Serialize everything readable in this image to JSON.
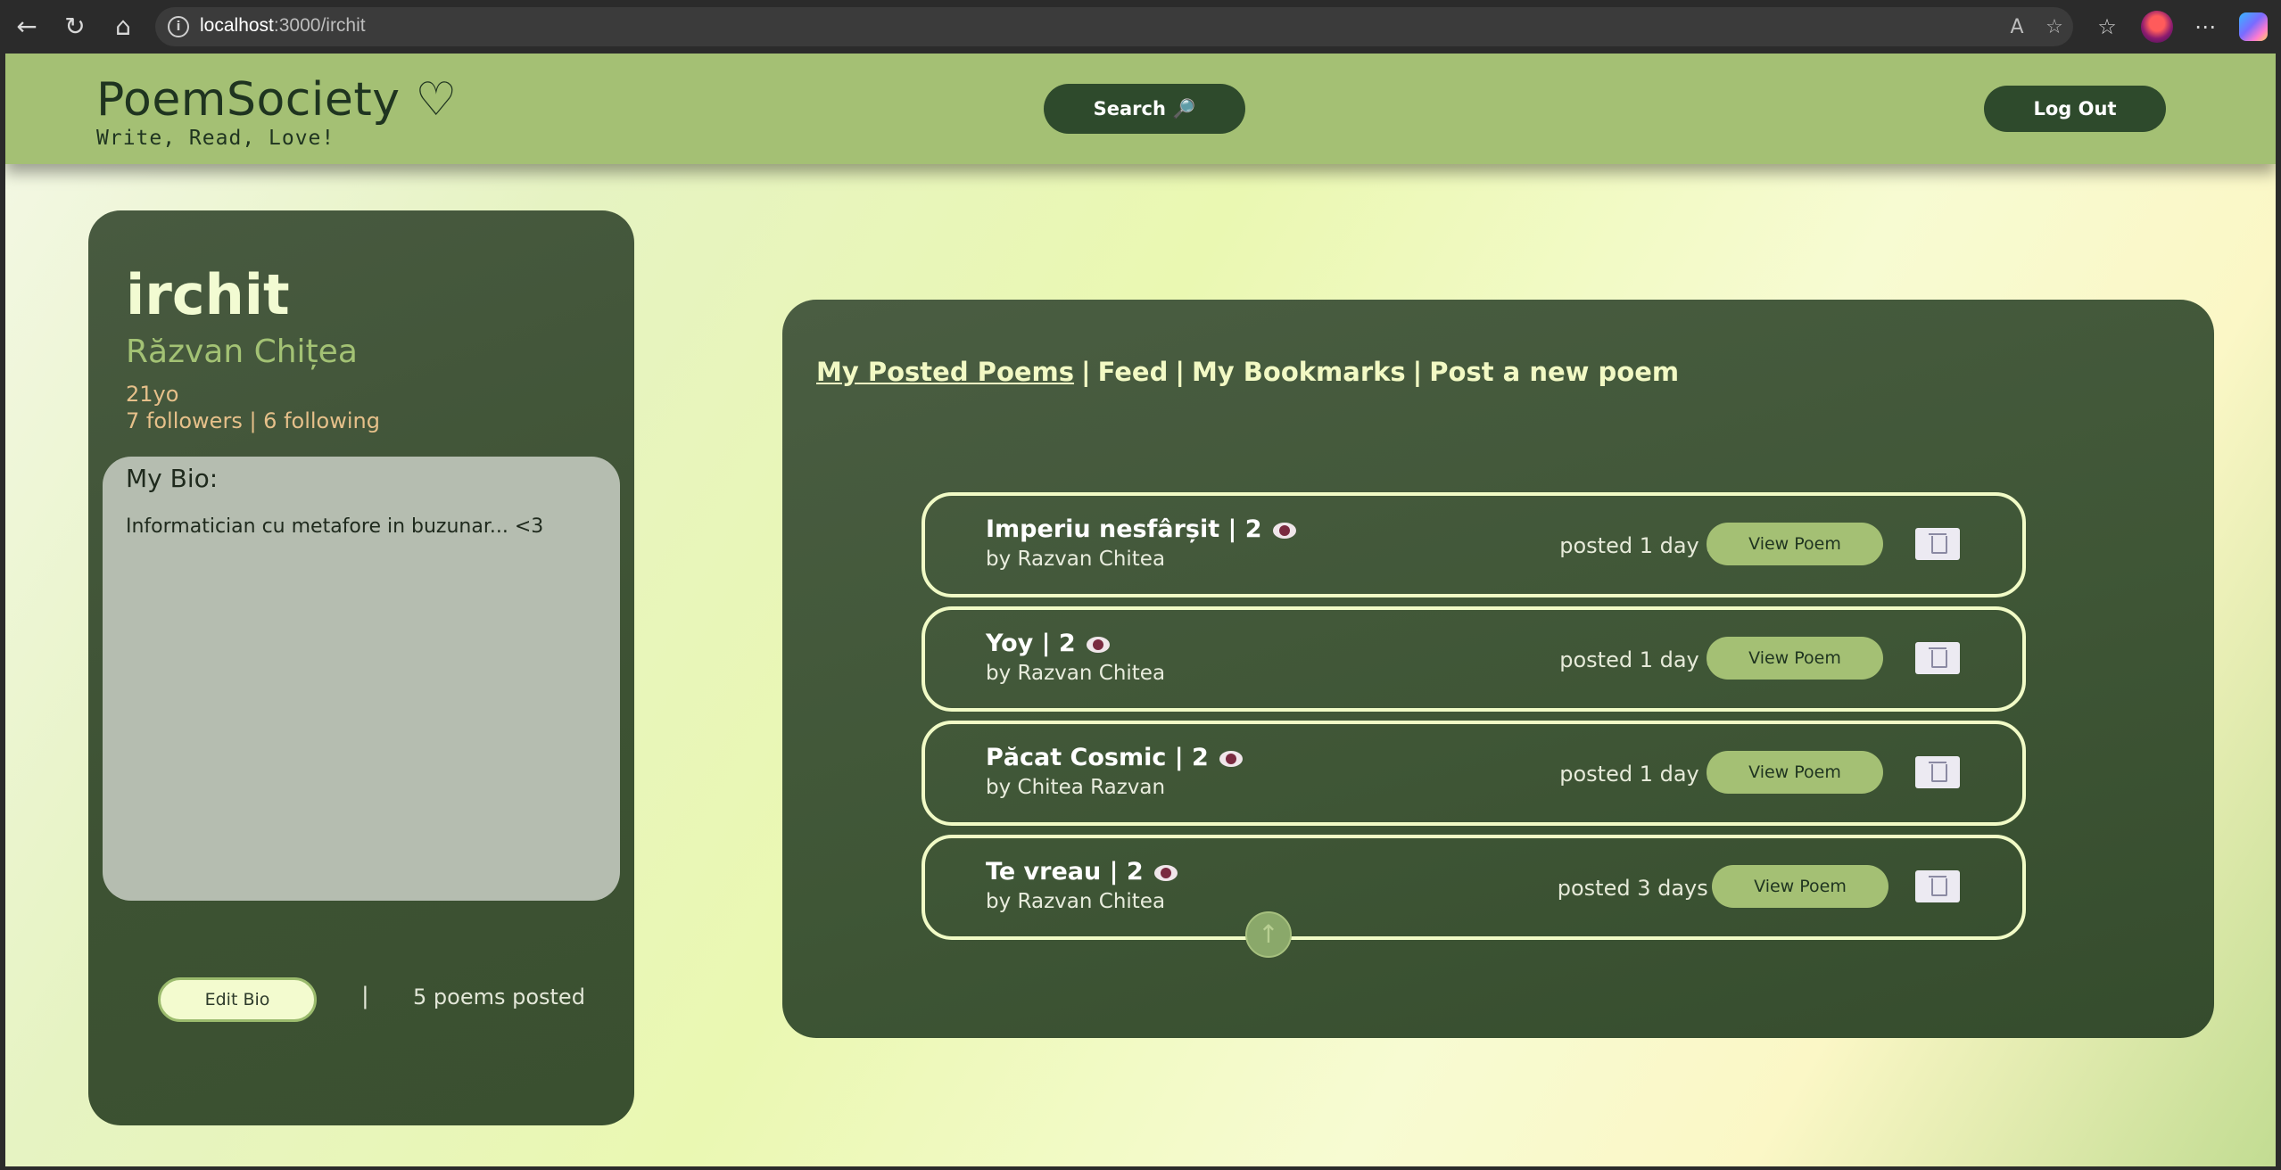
{
  "browser": {
    "url_host": "localhost",
    "url_path": ":3000/irchit"
  },
  "header": {
    "brand": "PoemSociety",
    "brand_icon": "♡",
    "tagline": "Write, Read, Love!",
    "search_label": "Search 🔎",
    "logout_label": "Log Out"
  },
  "profile": {
    "username": "irchit",
    "full_name": "Răzvan Chițea",
    "age": "21yo",
    "followers": "7 followers",
    "following": "6 following",
    "bio_title": "My Bio:",
    "bio_text": "Informatician cu metafore in buzunar... <3",
    "edit_bio_label": "Edit Bio",
    "separator": "|",
    "poems_posted": "5 poems posted"
  },
  "tabs": [
    {
      "label": "My Posted Poems",
      "active": true
    },
    {
      "label": "Feed"
    },
    {
      "label": "My Bookmarks"
    },
    {
      "label": "Post a new poem"
    }
  ],
  "poems": [
    {
      "title": "Imperiu nesfârșit | 2",
      "author": "by Razvan Chitea",
      "posted": "posted 1 day ago",
      "view_label": "View Poem"
    },
    {
      "title": "Yoy | 2",
      "author": "by Razvan Chitea",
      "posted": "posted 1 day ago",
      "view_label": "View Poem"
    },
    {
      "title": "Păcat Cosmic | 2",
      "author": "by Chitea Razvan",
      "posted": "posted 1 day ago",
      "view_label": "View Poem"
    },
    {
      "title": "Te vreau | 2",
      "author": "by Razvan Chitea",
      "posted": "posted 3 days ago",
      "view_label": "View Poem"
    }
  ],
  "pagination": {
    "up_arrow": "↑",
    "down_arrow": "↓"
  },
  "colors": {
    "accent": "#a4c074",
    "panel": "#3f5636",
    "dark_button": "#2e4a2c"
  }
}
